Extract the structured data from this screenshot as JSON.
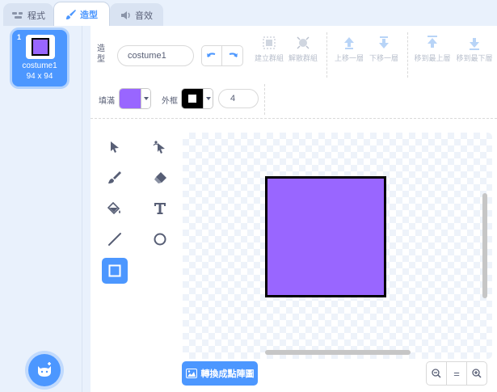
{
  "tabs": [
    {
      "label": "程式",
      "icon": "code-icon"
    },
    {
      "label": "造型",
      "icon": "brush-icon"
    },
    {
      "label": "音效",
      "icon": "speaker-icon"
    }
  ],
  "costumes": [
    {
      "number": "1",
      "name": "costume1",
      "size": "94 x 94"
    }
  ],
  "editor": {
    "costume_label": "造型",
    "costume_name": "costume1",
    "toolbar": {
      "group": "建立群組",
      "ungroup": "解散群組",
      "forward": "上移一層",
      "backward": "下移一層",
      "front": "移到最上層",
      "back": "移到最下層"
    },
    "fill_label": "填滿",
    "outline_label": "外框",
    "outline_width": "4",
    "fill_color": "#9966ff",
    "outline_color": "#000000"
  },
  "tools": [
    "select-icon",
    "reshape-icon",
    "brush-icon",
    "eraser-icon",
    "fill-icon",
    "text-icon",
    "line-icon",
    "circle-icon",
    "rectangle-icon"
  ],
  "selected_tool": "rectangle-icon",
  "bottom": {
    "convert_label": "轉換成點陣圖",
    "zoom_reset": "="
  },
  "colors": {
    "accent": "#4c97ff",
    "shape_fill": "#9966ff"
  }
}
